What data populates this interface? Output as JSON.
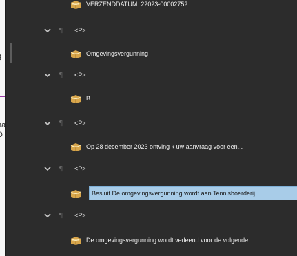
{
  "doc_fragments": [
    "g",
    "r",
    "na",
    "D"
  ],
  "tree": [
    {
      "kind": "content",
      "label": "VERZENDDATUM: 22023-0000275?",
      "selected": false
    },
    {
      "kind": "tag",
      "label": "<P>"
    },
    {
      "kind": "content",
      "label": "Omgevingsvergunning",
      "selected": false
    },
    {
      "kind": "tag",
      "label": "<P>"
    },
    {
      "kind": "content",
      "label": "B",
      "selected": false
    },
    {
      "kind": "tag",
      "label": "<P>"
    },
    {
      "kind": "content",
      "label": "Op 28 december 2023 ontving k uw aanvraag voor een...",
      "selected": false
    },
    {
      "kind": "tag",
      "label": "<P>"
    },
    {
      "kind": "content",
      "label": "Besluit De omgevingsvergunning wordt aan Tennisboerderij...",
      "selected": true
    },
    {
      "kind": "tag",
      "label": "<P>"
    },
    {
      "kind": "content",
      "label": "De omgevingsvergunning wordt verleend voor de volgende..."
    }
  ],
  "colors": {
    "panel_bg": "#2c2c2c",
    "selection_bg": "#a8cce8",
    "doc_divider": "#9b3aa6"
  },
  "icons": {
    "expand": "chevron-down-icon",
    "paragraph": "pilcrow-icon",
    "content": "container-box-icon"
  }
}
